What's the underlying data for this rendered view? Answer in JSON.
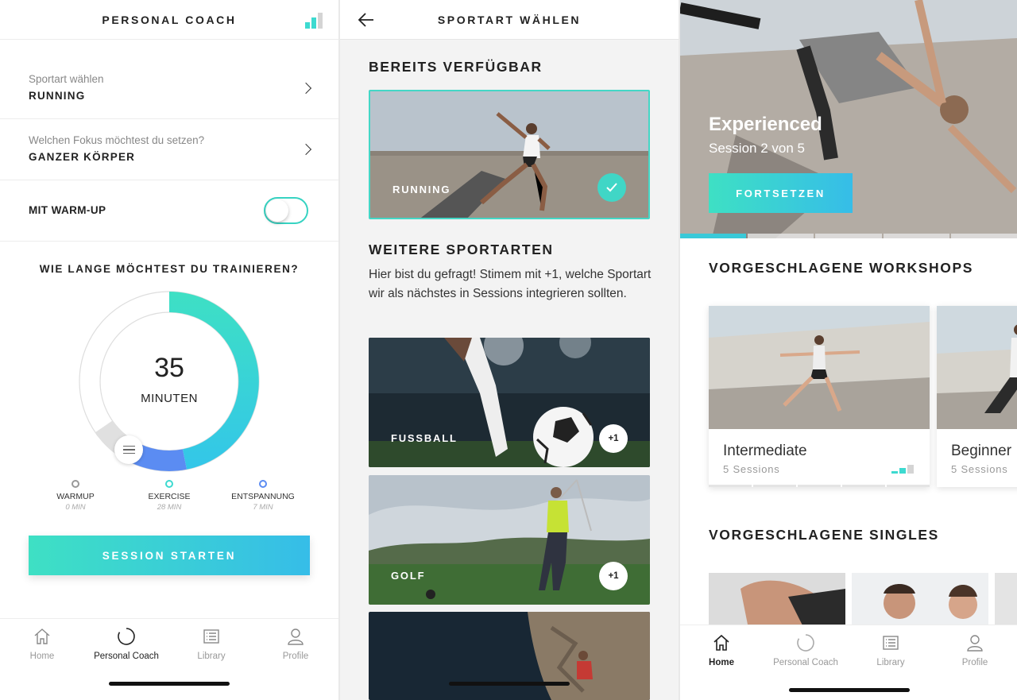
{
  "coach": {
    "title": "PERSONAL COACH",
    "sport_label": "Sportart wählen",
    "sport_value": "RUNNING",
    "focus_label": "Welchen Fokus möchtest du setzen?",
    "focus_value": "GANZER KÖRPER",
    "warmup_label": "MIT WARM-UP",
    "warmup_on": false,
    "duration_question": "WIE LANGE MÖCHTEST DU TRAINIEREN?",
    "duration_value": "35",
    "duration_unit": "MINUTEN",
    "segments": [
      {
        "name": "WARMUP",
        "minutes": "0 MIN",
        "color": "#999999"
      },
      {
        "name": "EXERCISE",
        "minutes": "28 MIN",
        "color": "#3ddad0"
      },
      {
        "name": "ENTSPANNUNG",
        "minutes": "7 MIN",
        "color": "#5b8cf2"
      }
    ],
    "start_button": "SESSION STARTEN"
  },
  "tabs_left": [
    {
      "label": "Home",
      "icon": "home-icon",
      "active": false
    },
    {
      "label": "Personal Coach",
      "icon": "coach-icon",
      "active": true
    },
    {
      "label": "Library",
      "icon": "library-icon",
      "active": false
    },
    {
      "label": "Profile",
      "icon": "profile-icon",
      "active": false
    }
  ],
  "sport_select": {
    "title": "SPORTART WÄHLEN",
    "available_heading": "BEREITS VERFÜGBAR",
    "available": [
      {
        "label": "RUNNING",
        "selected": true
      }
    ],
    "more_heading": "WEITERE SPORTARTEN",
    "description": "Hier bist du gefragt! Stimem mit +1, welche Sportart wir als nächstes in Sessions integrieren sollten.",
    "more": [
      {
        "label": "FUSSBALL",
        "vote": "+1"
      },
      {
        "label": "GOLF",
        "vote": "+1"
      }
    ]
  },
  "home": {
    "hero_title": "Experienced",
    "hero_subtitle": "Session 2 von 5",
    "continue_button": "FORTSETZEN",
    "workshops_heading": "VORGESCHLAGENE WORKSHOPS",
    "workshops": [
      {
        "title": "Intermediate",
        "sessions": "5 Sessions"
      },
      {
        "title": "Beginner",
        "sessions": "5 Sessions"
      }
    ],
    "singles_heading": "VORGESCHLAGENE SINGLES"
  },
  "tabs_right": [
    {
      "label": "Home",
      "icon": "home-icon",
      "active": true
    },
    {
      "label": "Personal Coach",
      "icon": "coach-icon",
      "active": false
    },
    {
      "label": "Library",
      "icon": "library-icon",
      "active": false
    },
    {
      "label": "Profile",
      "icon": "profile-icon",
      "active": false
    }
  ],
  "colors": {
    "accent_start": "#3ee0c4",
    "accent_end": "#36bde8",
    "relax_blue": "#5b8cf2"
  }
}
